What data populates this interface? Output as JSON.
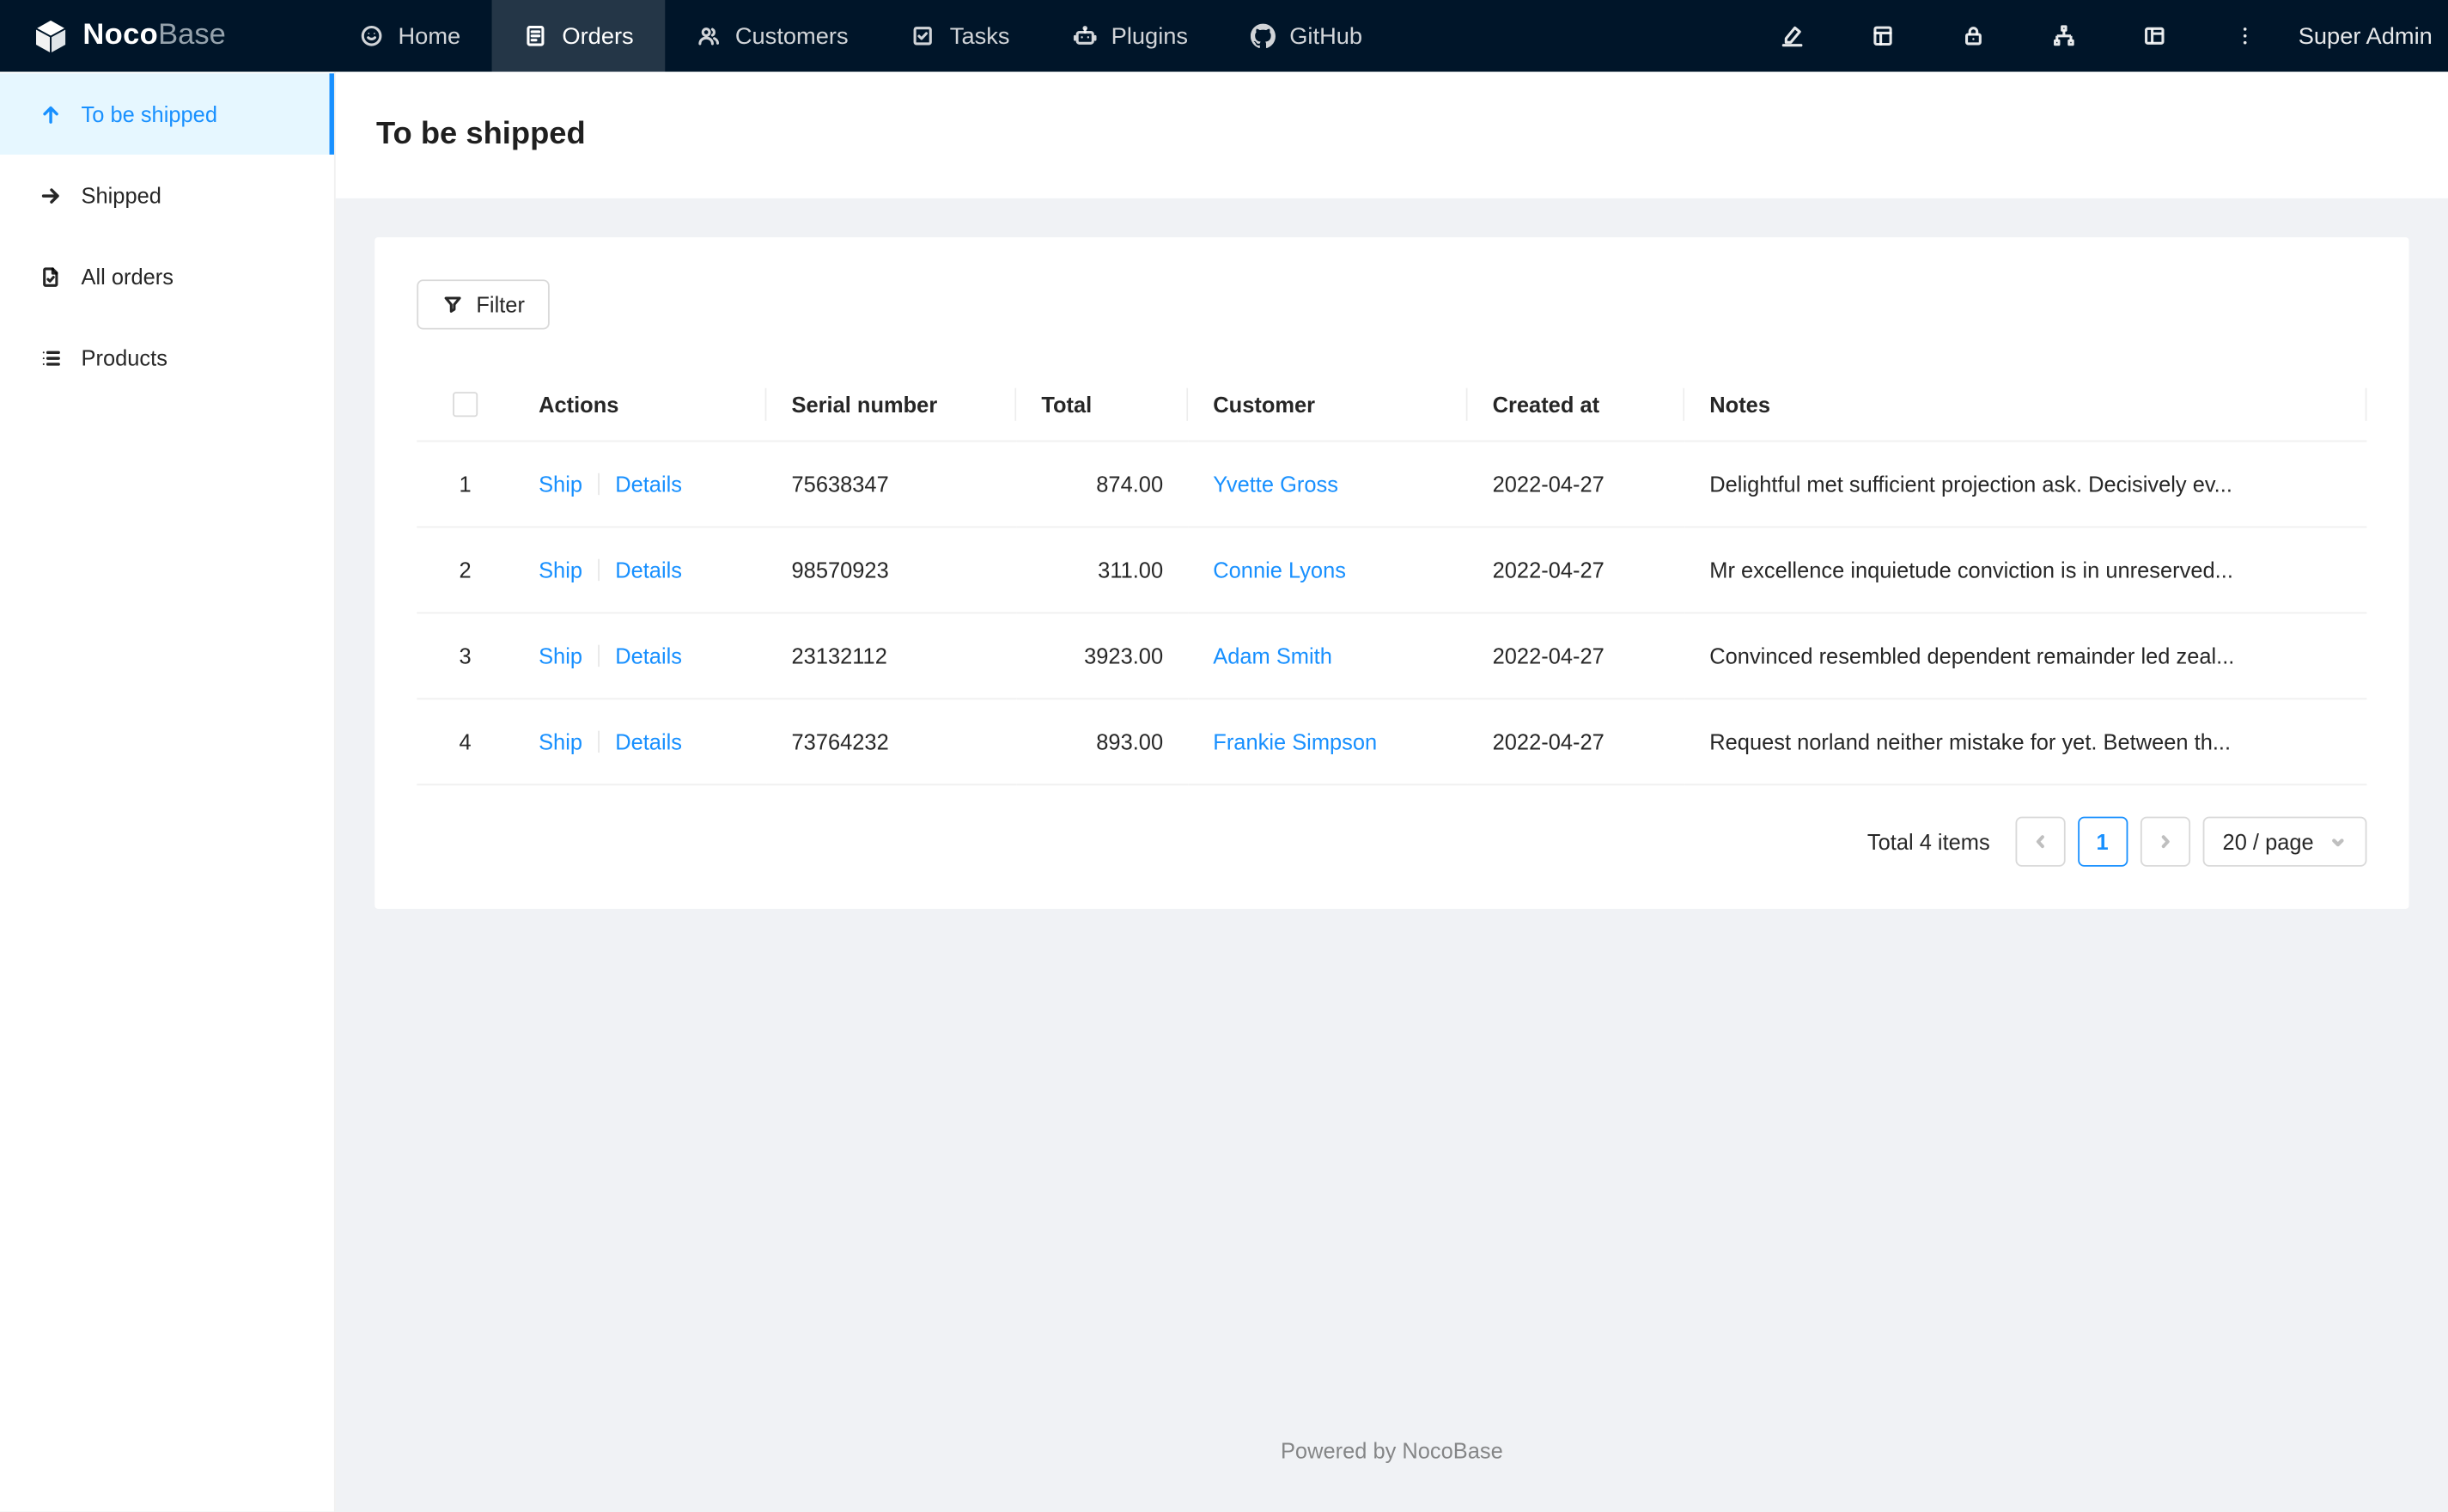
{
  "navbar": {
    "logo_noco": "Noco",
    "logo_base": "Base",
    "items": [
      {
        "label": "Home",
        "icon": "home-icon",
        "active": false
      },
      {
        "label": "Orders",
        "icon": "orders-icon",
        "active": true
      },
      {
        "label": "Customers",
        "icon": "customers-icon",
        "active": false
      },
      {
        "label": "Tasks",
        "icon": "tasks-icon",
        "active": false
      },
      {
        "label": "Plugins",
        "icon": "plugins-icon",
        "active": false
      },
      {
        "label": "GitHub",
        "icon": "github-icon",
        "active": false
      }
    ],
    "user": "Super Admin"
  },
  "sidebar": {
    "items": [
      {
        "label": "To be shipped",
        "icon": "arrow-up-icon",
        "active": true
      },
      {
        "label": "Shipped",
        "icon": "arrow-right-icon",
        "active": false
      },
      {
        "label": "All orders",
        "icon": "file-check-icon",
        "active": false
      },
      {
        "label": "Products",
        "icon": "list-icon",
        "active": false
      }
    ]
  },
  "page": {
    "title": "To be shipped"
  },
  "toolbar": {
    "filter_label": "Filter"
  },
  "table": {
    "headers": [
      "Actions",
      "Serial number",
      "Total",
      "Customer",
      "Created at",
      "Notes"
    ],
    "action_labels": {
      "ship": "Ship",
      "details": "Details"
    },
    "rows": [
      {
        "index": "1",
        "serial": "75638347",
        "total": "874.00",
        "customer": "Yvette Gross",
        "created": "2022-04-27",
        "notes": "Delightful met sufficient projection ask. Decisively ev..."
      },
      {
        "index": "2",
        "serial": "98570923",
        "total": "311.00",
        "customer": "Connie Lyons",
        "created": "2022-04-27",
        "notes": "Mr excellence inquietude conviction is in unreserved..."
      },
      {
        "index": "3",
        "serial": "23132112",
        "total": "3923.00",
        "customer": "Adam Smith",
        "created": "2022-04-27",
        "notes": "Convinced resembled dependent remainder led zeal..."
      },
      {
        "index": "4",
        "serial": "73764232",
        "total": "893.00",
        "customer": "Frankie Simpson",
        "created": "2022-04-27",
        "notes": "Request norland neither mistake for yet. Between th..."
      }
    ]
  },
  "pagination": {
    "total_text": "Total 4 items",
    "current_page": "1",
    "page_size": "20 / page"
  },
  "footer": {
    "text": "Powered by NocoBase"
  },
  "icons": {
    "nocobase-logo-icon": "white 3d cube",
    "home-icon": "smiley circle",
    "orders-icon": "document with lines",
    "customers-icon": "two people",
    "tasks-icon": "check square",
    "plugins-icon": "robot",
    "github-icon": "github octocat mark",
    "highlighter-icon": "marker pen",
    "table-icon": "spreadsheet grid",
    "lock-icon": "padlock",
    "apartment-icon": "connected nodes",
    "layout-icon": "layout columns",
    "more-icon": "vertical ellipsis",
    "filter-icon": "funnel",
    "chevron-left-icon": "‹",
    "chevron-right-icon": "›",
    "chevron-down-icon": "▾"
  },
  "colors": {
    "accent": "#1890ff",
    "navbar_bg": "#001529",
    "active_item_bg": "#e6f7ff",
    "content_bg": "#f0f2f5"
  }
}
